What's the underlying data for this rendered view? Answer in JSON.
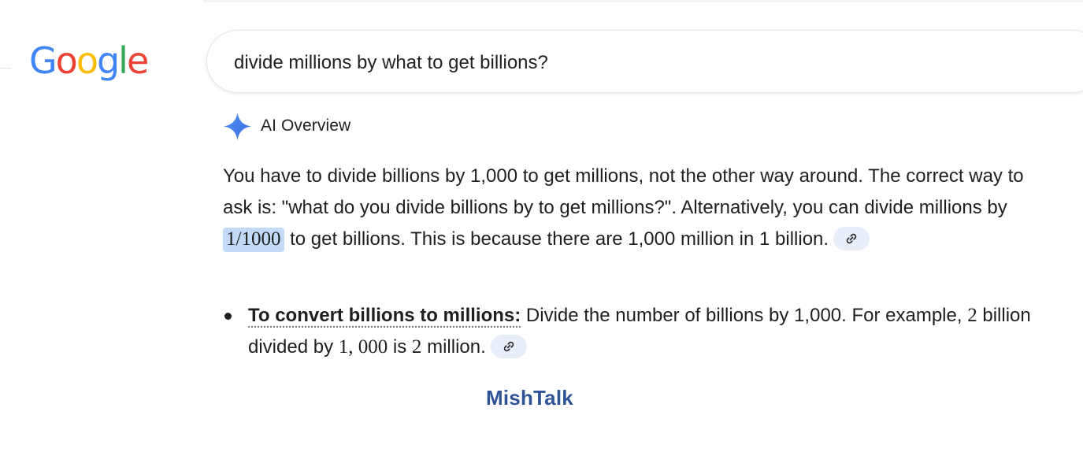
{
  "logo": {
    "letters": [
      "G",
      "o",
      "o",
      "g",
      "l",
      "e"
    ],
    "colors": [
      "#4285F4",
      "#EA4335",
      "#FBBC05",
      "#4285F4",
      "#34A853",
      "#EA4335"
    ]
  },
  "search": {
    "query": "divide millions by what to get billions?"
  },
  "ai_overview": {
    "title": "AI Overview",
    "icon": "sparkle-icon",
    "paragraph": {
      "part1": "You have to divide billions by 1,000 to get millions, not the other way around. The correct way to ask is: \"what do you divide billions by to get millions?\". Alternatively, you can divide millions by ",
      "highlight": "1/1000",
      "part2": " to get billions. This is because there are 1,000 million in 1 billion."
    },
    "bullets": [
      {
        "heading": "To convert billions to millions:",
        "text1": " Divide the number of billions by 1,000. For example, ",
        "num1": "2",
        "text2": " billion divided by ",
        "num2": "1, 000",
        "text3": " is ",
        "num3": "2",
        "text4": " million."
      }
    ],
    "link_icon": "link-icon",
    "accent_color": "#c2daf8"
  },
  "watermark": "MishTalk"
}
